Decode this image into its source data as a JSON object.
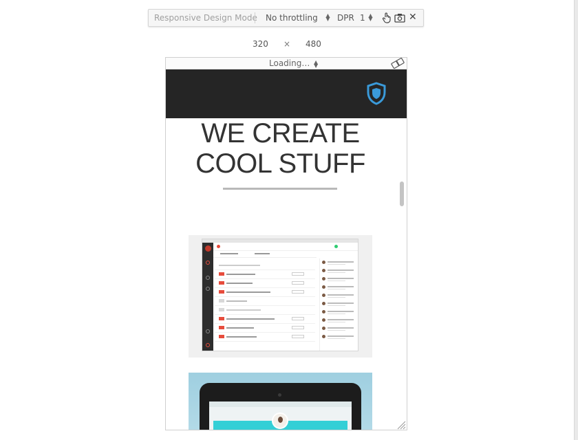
{
  "toolbar": {
    "mode": "Responsive Design Mode",
    "throttling": "No throttling",
    "dpr_label": "DPR",
    "dpr_value": "1",
    "icons": [
      "touch-icon",
      "camera-icon",
      "close-icon"
    ]
  },
  "viewport": {
    "width": "320",
    "separator": "×",
    "height": "480"
  },
  "device_bar": {
    "label": "Loading…",
    "icon": "rotate-icon"
  },
  "site": {
    "logo_icon": "shield-icon",
    "hero_line1": "WE CREATE",
    "hero_line2": "COOL STUFF"
  },
  "colors": {
    "header_bg": "#252525",
    "logo": "#3a9ad9",
    "accent_red": "#e74c3c",
    "tablet_accent": "#33cfd6"
  }
}
